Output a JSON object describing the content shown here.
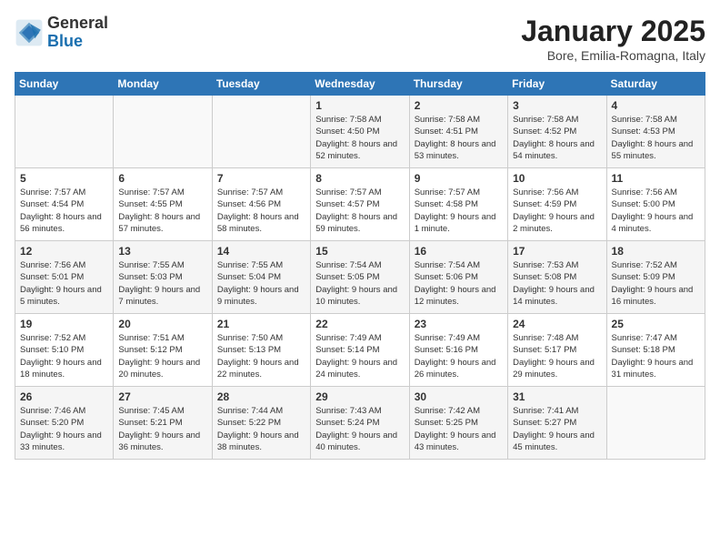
{
  "logo": {
    "general": "General",
    "blue": "Blue"
  },
  "title": "January 2025",
  "subtitle": "Bore, Emilia-Romagna, Italy",
  "days_of_week": [
    "Sunday",
    "Monday",
    "Tuesday",
    "Wednesday",
    "Thursday",
    "Friday",
    "Saturday"
  ],
  "weeks": [
    [
      {
        "day": "",
        "info": ""
      },
      {
        "day": "",
        "info": ""
      },
      {
        "day": "",
        "info": ""
      },
      {
        "day": "1",
        "info": "Sunrise: 7:58 AM\nSunset: 4:50 PM\nDaylight: 8 hours and 52 minutes."
      },
      {
        "day": "2",
        "info": "Sunrise: 7:58 AM\nSunset: 4:51 PM\nDaylight: 8 hours and 53 minutes."
      },
      {
        "day": "3",
        "info": "Sunrise: 7:58 AM\nSunset: 4:52 PM\nDaylight: 8 hours and 54 minutes."
      },
      {
        "day": "4",
        "info": "Sunrise: 7:58 AM\nSunset: 4:53 PM\nDaylight: 8 hours and 55 minutes."
      }
    ],
    [
      {
        "day": "5",
        "info": "Sunrise: 7:57 AM\nSunset: 4:54 PM\nDaylight: 8 hours and 56 minutes."
      },
      {
        "day": "6",
        "info": "Sunrise: 7:57 AM\nSunset: 4:55 PM\nDaylight: 8 hours and 57 minutes."
      },
      {
        "day": "7",
        "info": "Sunrise: 7:57 AM\nSunset: 4:56 PM\nDaylight: 8 hours and 58 minutes."
      },
      {
        "day": "8",
        "info": "Sunrise: 7:57 AM\nSunset: 4:57 PM\nDaylight: 8 hours and 59 minutes."
      },
      {
        "day": "9",
        "info": "Sunrise: 7:57 AM\nSunset: 4:58 PM\nDaylight: 9 hours and 1 minute."
      },
      {
        "day": "10",
        "info": "Sunrise: 7:56 AM\nSunset: 4:59 PM\nDaylight: 9 hours and 2 minutes."
      },
      {
        "day": "11",
        "info": "Sunrise: 7:56 AM\nSunset: 5:00 PM\nDaylight: 9 hours and 4 minutes."
      }
    ],
    [
      {
        "day": "12",
        "info": "Sunrise: 7:56 AM\nSunset: 5:01 PM\nDaylight: 9 hours and 5 minutes."
      },
      {
        "day": "13",
        "info": "Sunrise: 7:55 AM\nSunset: 5:03 PM\nDaylight: 9 hours and 7 minutes."
      },
      {
        "day": "14",
        "info": "Sunrise: 7:55 AM\nSunset: 5:04 PM\nDaylight: 9 hours and 9 minutes."
      },
      {
        "day": "15",
        "info": "Sunrise: 7:54 AM\nSunset: 5:05 PM\nDaylight: 9 hours and 10 minutes."
      },
      {
        "day": "16",
        "info": "Sunrise: 7:54 AM\nSunset: 5:06 PM\nDaylight: 9 hours and 12 minutes."
      },
      {
        "day": "17",
        "info": "Sunrise: 7:53 AM\nSunset: 5:08 PM\nDaylight: 9 hours and 14 minutes."
      },
      {
        "day": "18",
        "info": "Sunrise: 7:52 AM\nSunset: 5:09 PM\nDaylight: 9 hours and 16 minutes."
      }
    ],
    [
      {
        "day": "19",
        "info": "Sunrise: 7:52 AM\nSunset: 5:10 PM\nDaylight: 9 hours and 18 minutes."
      },
      {
        "day": "20",
        "info": "Sunrise: 7:51 AM\nSunset: 5:12 PM\nDaylight: 9 hours and 20 minutes."
      },
      {
        "day": "21",
        "info": "Sunrise: 7:50 AM\nSunset: 5:13 PM\nDaylight: 9 hours and 22 minutes."
      },
      {
        "day": "22",
        "info": "Sunrise: 7:49 AM\nSunset: 5:14 PM\nDaylight: 9 hours and 24 minutes."
      },
      {
        "day": "23",
        "info": "Sunrise: 7:49 AM\nSunset: 5:16 PM\nDaylight: 9 hours and 26 minutes."
      },
      {
        "day": "24",
        "info": "Sunrise: 7:48 AM\nSunset: 5:17 PM\nDaylight: 9 hours and 29 minutes."
      },
      {
        "day": "25",
        "info": "Sunrise: 7:47 AM\nSunset: 5:18 PM\nDaylight: 9 hours and 31 minutes."
      }
    ],
    [
      {
        "day": "26",
        "info": "Sunrise: 7:46 AM\nSunset: 5:20 PM\nDaylight: 9 hours and 33 minutes."
      },
      {
        "day": "27",
        "info": "Sunrise: 7:45 AM\nSunset: 5:21 PM\nDaylight: 9 hours and 36 minutes."
      },
      {
        "day": "28",
        "info": "Sunrise: 7:44 AM\nSunset: 5:22 PM\nDaylight: 9 hours and 38 minutes."
      },
      {
        "day": "29",
        "info": "Sunrise: 7:43 AM\nSunset: 5:24 PM\nDaylight: 9 hours and 40 minutes."
      },
      {
        "day": "30",
        "info": "Sunrise: 7:42 AM\nSunset: 5:25 PM\nDaylight: 9 hours and 43 minutes."
      },
      {
        "day": "31",
        "info": "Sunrise: 7:41 AM\nSunset: 5:27 PM\nDaylight: 9 hours and 45 minutes."
      },
      {
        "day": "",
        "info": ""
      }
    ]
  ]
}
